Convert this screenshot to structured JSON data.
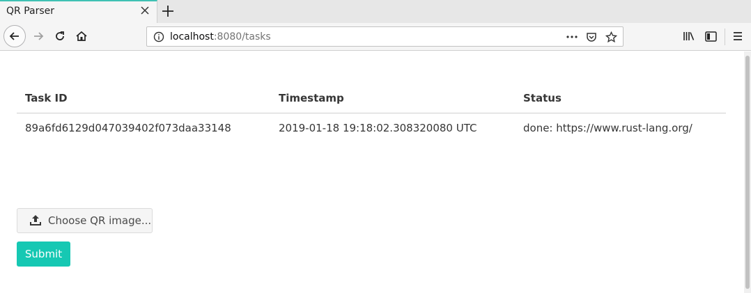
{
  "browser": {
    "tab_title": "QR Parser",
    "url_host": "localhost",
    "url_rest": ":8080/tasks",
    "accent": "#3fc1b3"
  },
  "toolbar_icons": [
    "back-icon",
    "forward-icon",
    "reload-icon",
    "home-icon",
    "info-icon",
    "more-icon",
    "pocket-icon",
    "bookmark-star-icon",
    "library-icon",
    "sidebar-icon",
    "menu-icon"
  ],
  "table": {
    "headers": [
      "Task ID",
      "Timestamp",
      "Status"
    ],
    "rows": [
      [
        "89a6fd6129d047039402f073daa33148",
        "2019-01-18 19:18:02.308320080 UTC",
        "done: https://www.rust-lang.org/"
      ]
    ]
  },
  "form": {
    "file_label": "Choose QR image...",
    "submit_label": "Submit",
    "submit_color": "#16c8b3"
  }
}
